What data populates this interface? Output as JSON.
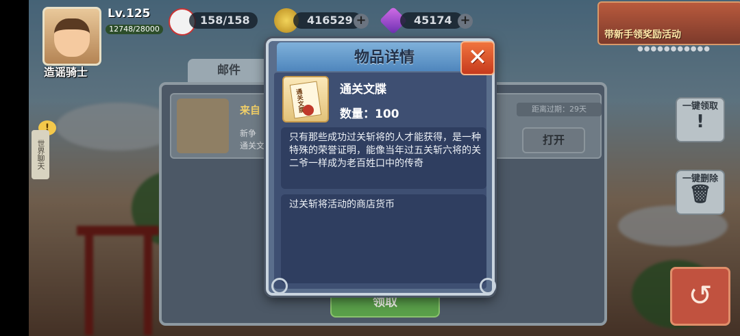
{
  "player": {
    "name": "造谣骑士",
    "level": "Lv.125",
    "exp": "12748/28000"
  },
  "resources": {
    "stamina": "158/158",
    "coins": "416529",
    "diamonds": "45174",
    "plus": "+"
  },
  "promo": {
    "label": "带新手领奖励活动",
    "dots": "●●●●●●●●●●●"
  },
  "mail": {
    "tab_label": "邮件",
    "from": "来自",
    "line1": "新争",
    "line2": "通关文",
    "expiry": "距离过期：29天",
    "open_button": "打开",
    "claim_button": "领取",
    "claim_all": "一键领取",
    "delete_all": "一键删除"
  },
  "chat": {
    "tab_label": "世界聊天",
    "alert": "!"
  },
  "modal": {
    "title": "物品详情",
    "close": "✕",
    "item_name": "通关文牒",
    "item_icon_text": "通关文牒",
    "quantity": "数量：100",
    "description": "只有那些成功过关斩将的人才能获得，是一种特殊的荣誉证明，能像当年过五关斩六将的关二爷一样成为老百姓口中的传奇",
    "usage": "过关斩将活动的商店货币"
  },
  "colors": {
    "modal_header": "#4f86bd",
    "modal_body": "#3e4f72",
    "close_button": "#c63a1d",
    "claim_button": "#5aa04a"
  }
}
